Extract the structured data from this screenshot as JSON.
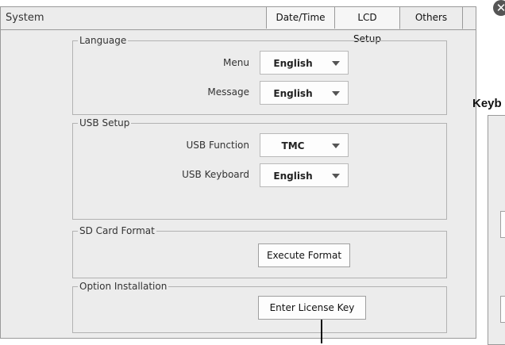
{
  "window": {
    "title": "System"
  },
  "tabs": [
    {
      "label": "Date/Time",
      "active": false
    },
    {
      "label": "LCD Setup",
      "active": false
    },
    {
      "label": "Others",
      "active": true
    }
  ],
  "language": {
    "title": "Language",
    "menu": {
      "label": "Menu",
      "value": "English"
    },
    "message": {
      "label": "Message",
      "value": "English"
    }
  },
  "usb": {
    "title": "USB Setup",
    "function": {
      "label": "USB Function",
      "value": "TMC"
    },
    "keyboard": {
      "label": "USB Keyboard",
      "value": "English"
    }
  },
  "sd": {
    "title": "SD Card Format",
    "button": "Execute Format"
  },
  "option": {
    "title": "Option Installation",
    "button": "Enter License Key"
  },
  "side": {
    "title": "Keyb"
  },
  "icons": {
    "close": "close-icon",
    "dropdown": "chevron-down-icon"
  }
}
